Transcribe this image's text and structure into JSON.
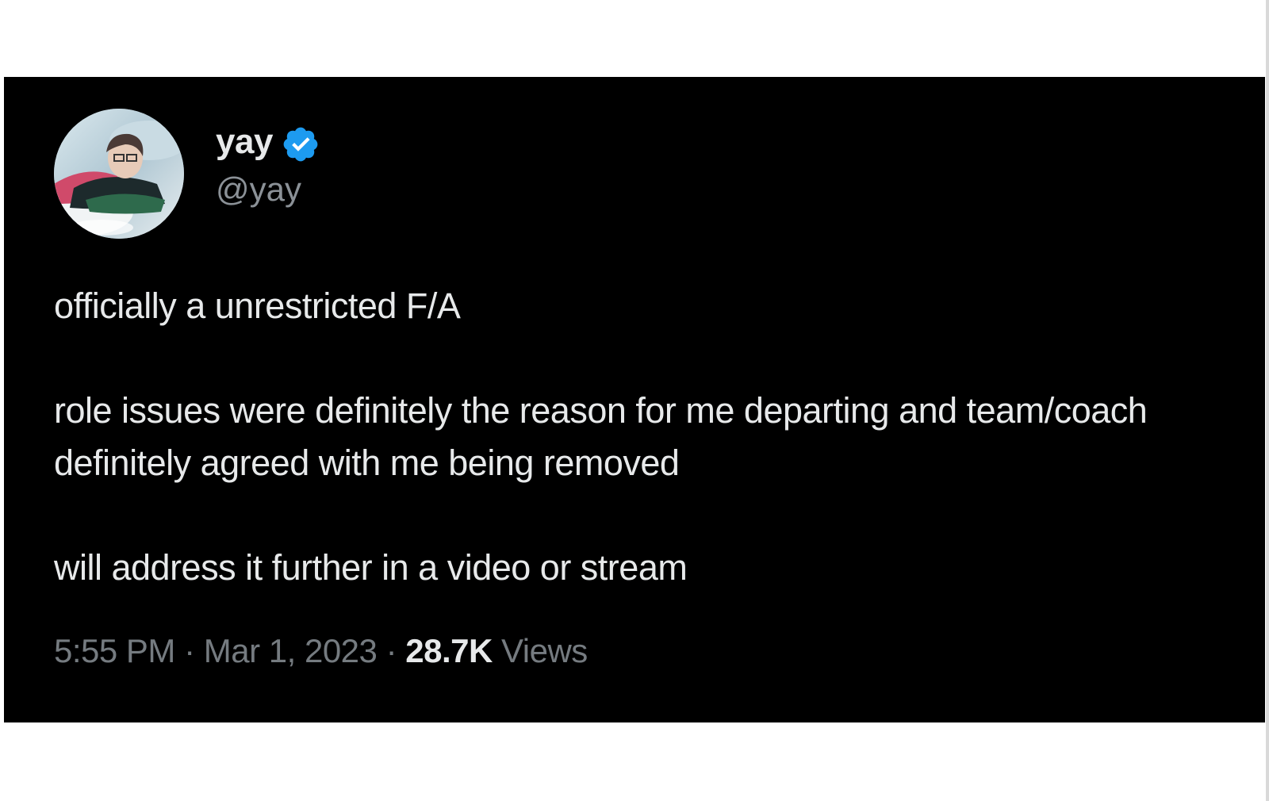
{
  "tweet": {
    "display_name": "yay",
    "handle": "@yay",
    "verified": true,
    "verified_icon": "verified-badge-icon",
    "avatar_icon": "profile-avatar",
    "text_paragraphs": [
      "officially a unrestricted F/A",
      "role issues were definitely the reason for me departing and team/coach definitely agreed with me being removed",
      "will address it further in a video or stream"
    ],
    "time": "5:55 PM",
    "separator": "·",
    "date": "Mar 1, 2023",
    "views_count": "28.7K",
    "views_label": "Views"
  },
  "colors": {
    "card_background": "#000000",
    "text_primary": "#e7e9ea",
    "text_secondary": "#8b9197",
    "verified_blue": "#1d9bf0",
    "page_background": "#ffffff"
  }
}
